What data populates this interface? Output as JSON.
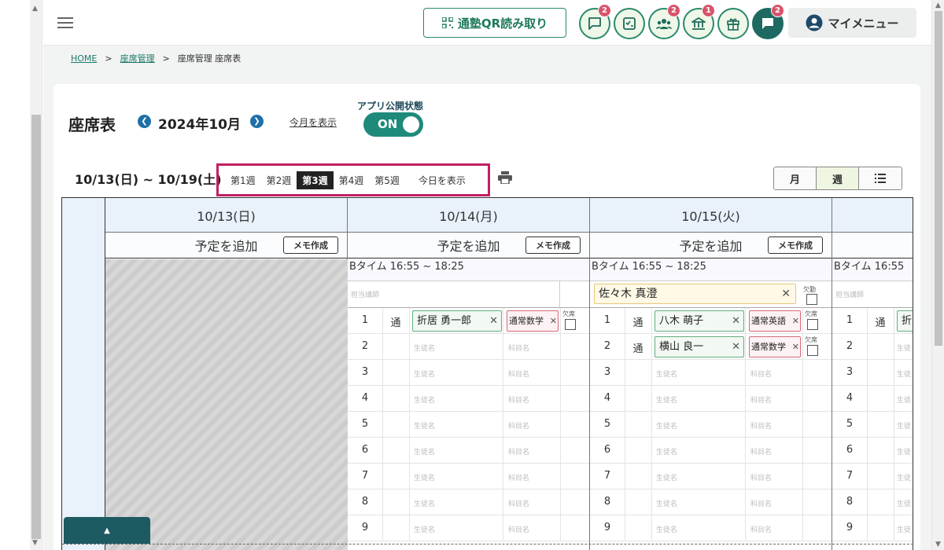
{
  "header": {
    "qr_label": "通塾QR読み取り",
    "my_menu_label": "マイメニュー",
    "icons": [
      {
        "name": "message-icon",
        "badge": "2"
      },
      {
        "name": "checklist-icon",
        "badge": ""
      },
      {
        "name": "group-icon",
        "badge": "2"
      },
      {
        "name": "bank-icon",
        "badge": "1"
      },
      {
        "name": "gift-icon",
        "badge": ""
      },
      {
        "name": "chat-icon",
        "badge": "2"
      }
    ]
  },
  "breadcrumb": {
    "home": "HOME",
    "seat_admin": "座席管理",
    "current": "座席管理 座席表"
  },
  "page": {
    "title": "座席表",
    "month": "2024年10月",
    "show_this_month": "今月を表示",
    "app_public_label": "アプリ公開状態",
    "toggle_state": "ON"
  },
  "week": {
    "range": "10/13(日) ~ 10/19(土)",
    "tabs": [
      "第1週",
      "第2週",
      "第3週",
      "第4週",
      "第5週"
    ],
    "active_index": 2,
    "today": "今日を表示"
  },
  "view_switch": {
    "month": "月",
    "week": "週",
    "list_icon": "list-icon",
    "active": "week"
  },
  "days": [
    {
      "date": "10/13(日)",
      "add_label": "予定を追加",
      "memo_label": "メモ作成",
      "closed": true
    },
    {
      "date": "10/14(月)",
      "add_label": "予定を追加",
      "memo_label": "メモ作成",
      "time": "Bタイム 16:55 ~ 18:25",
      "teacher_placeholder": "担当講師",
      "teacher": "",
      "seats": [
        {
          "no": "1",
          "kind": "通",
          "student": "折居 勇一郎",
          "subject": "通常数学",
          "absent_label": "欠席"
        },
        {
          "no": "2",
          "kind": "",
          "student": "",
          "subject": ""
        },
        {
          "no": "3",
          "kind": "",
          "student": "",
          "subject": ""
        },
        {
          "no": "4",
          "kind": "",
          "student": "",
          "subject": ""
        },
        {
          "no": "5",
          "kind": "",
          "student": "",
          "subject": ""
        },
        {
          "no": "6",
          "kind": "",
          "student": "",
          "subject": ""
        },
        {
          "no": "7",
          "kind": "",
          "student": "",
          "subject": ""
        },
        {
          "no": "8",
          "kind": "",
          "student": "",
          "subject": ""
        },
        {
          "no": "9",
          "kind": "",
          "student": "",
          "subject": ""
        }
      ]
    },
    {
      "date": "10/15(火)",
      "add_label": "予定を追加",
      "memo_label": "メモ作成",
      "time": "Bタイム 16:55 ~ 18:25",
      "teacher_placeholder": "担当講師",
      "teacher": "佐々木 真澄",
      "teacher_absent_label": "欠勤",
      "seats": [
        {
          "no": "1",
          "kind": "通",
          "student": "八木 萌子",
          "subject": "通常英語",
          "absent_label": "欠席"
        },
        {
          "no": "2",
          "kind": "通",
          "student": "横山 良一",
          "subject": "通常数学",
          "absent_label": "欠席"
        },
        {
          "no": "3",
          "kind": "",
          "student": "",
          "subject": ""
        },
        {
          "no": "4",
          "kind": "",
          "student": "",
          "subject": ""
        },
        {
          "no": "5",
          "kind": "",
          "student": "",
          "subject": ""
        },
        {
          "no": "6",
          "kind": "",
          "student": "",
          "subject": ""
        },
        {
          "no": "7",
          "kind": "",
          "student": "",
          "subject": ""
        },
        {
          "no": "8",
          "kind": "",
          "student": "",
          "subject": ""
        },
        {
          "no": "9",
          "kind": "",
          "student": "",
          "subject": ""
        }
      ]
    },
    {
      "date": "",
      "add_label": "",
      "memo_label": "",
      "time": "Bタイム 16:55",
      "teacher_placeholder": "担当講師",
      "teacher": "",
      "seats": [
        {
          "no": "1",
          "kind": "通",
          "student": "折",
          "subject": ""
        },
        {
          "no": "2",
          "kind": "",
          "student": "",
          "subject": ""
        },
        {
          "no": "3",
          "kind": "",
          "student": "",
          "subject": ""
        },
        {
          "no": "4",
          "kind": "",
          "student": "",
          "subject": ""
        },
        {
          "no": "5",
          "kind": "",
          "student": "",
          "subject": ""
        },
        {
          "no": "6",
          "kind": "",
          "student": "",
          "subject": ""
        },
        {
          "no": "7",
          "kind": "",
          "student": "",
          "subject": ""
        },
        {
          "no": "8",
          "kind": "",
          "student": "",
          "subject": ""
        },
        {
          "no": "9",
          "kind": "",
          "student": "",
          "subject": ""
        }
      ]
    }
  ],
  "placeholders": {
    "student": "生徒名",
    "subject": "科目名",
    "student_short": "生徒"
  },
  "colors": {
    "accent": "#1e8a7a",
    "highlight": "#c21f63",
    "badge": "#d8546a",
    "header_bg": "#e9f1fa"
  }
}
